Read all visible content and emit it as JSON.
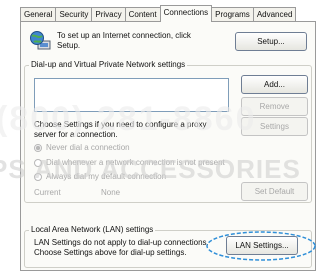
{
  "tabs": [
    "General",
    "Security",
    "Privacy",
    "Content",
    "Connections",
    "Programs",
    "Advanced"
  ],
  "active_tab": "Connections",
  "setup": {
    "line1": "To set up an Internet connection, click",
    "line2": "Setup.",
    "button": "Setup..."
  },
  "dialup": {
    "title": "Dial-up and Virtual Private Network settings",
    "add_button": "Add...",
    "remove_button": "Remove",
    "settings_button": "Settings",
    "choose_line1": "Choose Settings if you need to configure a proxy",
    "choose_line2": "server for a connection.",
    "radio_never": "Never dial a connection",
    "radio_whenever": "Dial whenever a network connection is not present",
    "radio_always": "Always dial my default connection",
    "current_label": "Current",
    "current_value": "None",
    "set_default_button": "Set Default"
  },
  "lan": {
    "title": "Local Area Network (LAN) settings",
    "line1": "LAN Settings do not apply to dial-up connections.",
    "line2": "Choose Settings above for dial-up settings.",
    "button": "LAN Settings..."
  },
  "watermark": {
    "line1": "(800) 281-8860",
    "line2": "PS AND ACCESSORIES"
  },
  "colors": {
    "callout": "#2f8fd8",
    "accent": "#0b5cad"
  },
  "icons": {
    "setup": "network-globe-icon",
    "callout": "highlight-ellipse"
  }
}
